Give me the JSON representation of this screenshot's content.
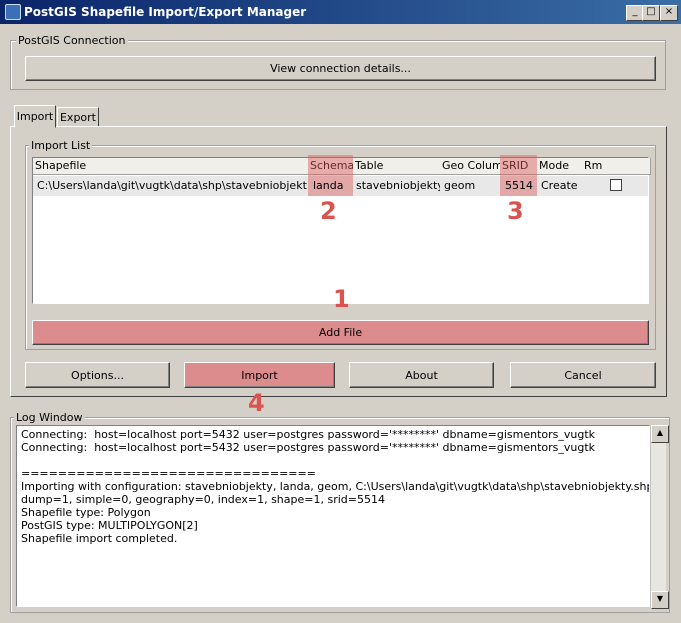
{
  "window": {
    "title": "PostGIS Shapefile Import/Export Manager",
    "min_glyph": "_",
    "max_glyph": "□",
    "close_glyph": "×"
  },
  "connection": {
    "group_label": "PostGIS Connection",
    "details_button": "View connection details..."
  },
  "tabs": [
    {
      "label": "Import",
      "active": true
    },
    {
      "label": "Export",
      "active": false
    }
  ],
  "import_list": {
    "group_label": "Import List",
    "columns": [
      "Shapefile",
      "Schema",
      "Table",
      "Geo Column",
      "SRID",
      "Mode",
      "Rm"
    ],
    "rows": [
      {
        "shapefile": "C:\\Users\\landa\\git\\vugtk\\data\\shp\\stavebniobjekty.shp",
        "schema": "landa",
        "table": "stavebniobjekty",
        "geo_column": "geom",
        "srid": "5514",
        "mode": "Create",
        "rm": false
      }
    ],
    "add_file_button": "Add File"
  },
  "actions": {
    "options": "Options...",
    "import": "Import",
    "about": "About",
    "cancel": "Cancel"
  },
  "annotations": [
    "1",
    "2",
    "3",
    "4"
  ],
  "log": {
    "group_label": "Log Window",
    "lines": [
      "Connecting:  host=localhost port=5432 user=postgres password='********' dbname=gismentors_vugtk",
      "Connecting:  host=localhost port=5432 user=postgres password='********' dbname=gismentors_vugtk",
      "",
      "================================",
      "Importing with configuration: stavebniobjekty, landa, geom, C:\\Users\\landa\\git\\vugtk\\data\\shp\\stavebniobjekty.shp, mode=c,",
      "dump=1, simple=0, geography=0, index=1, shape=1, srid=5514",
      "Shapefile type: Polygon",
      "PostGIS type: MULTIPOLYGON[2]",
      "Shapefile import completed."
    ]
  },
  "colors": {
    "highlight": "#d9534f",
    "titlebar": "#0a246a"
  }
}
